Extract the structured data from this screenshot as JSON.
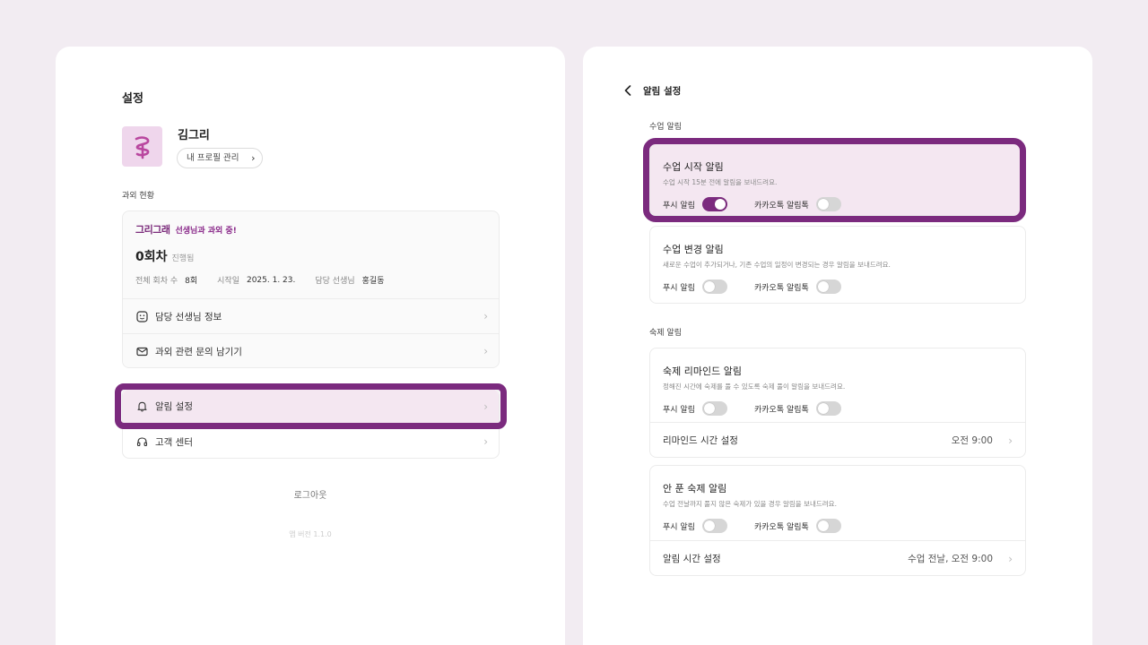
{
  "left": {
    "title": "설정",
    "user": {
      "name": "김그리",
      "profile_button": "내 프로필 관리"
    },
    "tutoring_status": {
      "section_label": "과외 현황",
      "brand": "그리그래",
      "brand_message": "선생님과 과외 중!",
      "count": "0회차",
      "count_status": "진행됨",
      "meta": [
        {
          "key": "전체 회차 수",
          "value": "8회"
        },
        {
          "key": "시작일",
          "value": "2025. 1. 23."
        },
        {
          "key": "담당 선생님",
          "value": "홍길동"
        }
      ],
      "items": [
        "담당 선생님 정보",
        "과외 관련 문의 남기기"
      ]
    },
    "menu": [
      "알림 설정",
      "고객 센터"
    ],
    "logout": "로그아웃",
    "version": "앱 버전 1.1.0"
  },
  "right": {
    "title": "알림 설정",
    "class_section": {
      "label": "수업 알림",
      "cards": [
        {
          "title": "수업 시작 알림",
          "desc": "수업 시작 15분 전에 알림을 보내드려요.",
          "push_label": "푸시 알림",
          "push_on": true,
          "kakao_label": "카카오톡 알림톡",
          "kakao_on": false
        },
        {
          "title": "수업 변경 알림",
          "desc": "새로운 수업이 추가되거나, 기존 수업의 일정이 변경되는 경우 알림을 보내드려요.",
          "push_label": "푸시 알림",
          "push_on": false,
          "kakao_label": "카카오톡 알림톡",
          "kakao_on": false
        }
      ]
    },
    "homework_section": {
      "label": "숙제 알림",
      "cards": [
        {
          "title": "숙제 리마인드 알림",
          "desc": "정해진 시간에 숙제를 풀 수 있도록 숙제 풀이 알림을 보내드려요.",
          "push_label": "푸시 알림",
          "push_on": false,
          "kakao_label": "카카오톡 알림톡",
          "kakao_on": false,
          "setting_label": "리마인드 시간 설정",
          "setting_value": "오전 9:00"
        },
        {
          "title": "안 푼 숙제 알림",
          "desc": "수업 전날까지 풀지 않은 숙제가 있을 경우 알림을 보내드려요.",
          "push_label": "푸시 알림",
          "push_on": false,
          "kakao_label": "카카오톡 알림톡",
          "kakao_on": false,
          "setting_label": "알림 시간 설정",
          "setting_value": "수업 전날, 오전 9:00"
        }
      ]
    }
  },
  "colors": {
    "accent": "#7b2a7e",
    "highlight_bg": "#f4e7f1",
    "page_bg": "#f2ecf2"
  }
}
